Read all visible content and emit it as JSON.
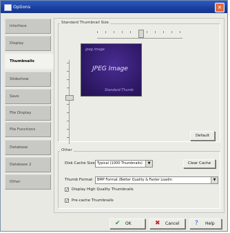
{
  "window": {
    "title": "Options",
    "close_glyph": "×"
  },
  "sidebar": {
    "items": [
      {
        "label": "Interface"
      },
      {
        "label": "Display"
      },
      {
        "label": "Thumbnails",
        "active": true
      },
      {
        "label": "Slideshow"
      },
      {
        "label": "Save"
      },
      {
        "label": "File Display"
      },
      {
        "label": "File Functions"
      },
      {
        "label": "Database"
      },
      {
        "label": "Database 2"
      },
      {
        "label": "Other"
      }
    ]
  },
  "thumb_size": {
    "group_label": "Standard Thumbnail Size",
    "preview_top": "jpeg image",
    "preview_main": "JPEG Image",
    "preview_bottom": "Standard Thumb",
    "default_button": "Default"
  },
  "other": {
    "group_label": "Other",
    "disk_cache_label": "Disk Cache Size",
    "disk_cache_value": "Typical (1000 Thumbnails)",
    "clear_cache_button": "Clear Cache",
    "thumb_format_label": "Thumb Format",
    "thumb_format_value": "BMP Format (Better Quality & Faster Loadin",
    "hq_thumbnails_label": "Display High Quality Thumbnails",
    "hq_thumbnails_checked": true,
    "precache_label": "Pre-cache Thumbnails",
    "precache_checked": true
  },
  "buttons": {
    "ok_label": "OK",
    "cancel_label": "Cancel",
    "help_label": "Help"
  },
  "colors": {
    "titlebar": "#1b3f9c",
    "ok_icon": "#1e9a2a",
    "cancel_icon": "#cc2020",
    "help_icon": "#2a52b8"
  }
}
